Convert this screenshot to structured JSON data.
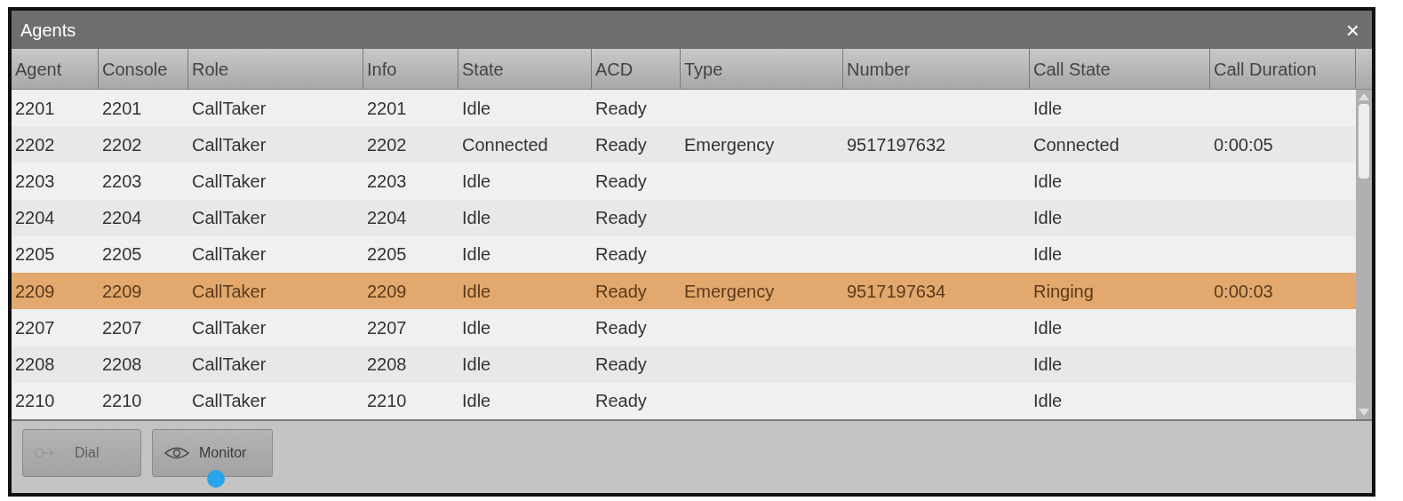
{
  "window": {
    "title": "Agents",
    "close": "×"
  },
  "table": {
    "columns": [
      "Agent",
      "Console",
      "Role",
      "Info",
      "State",
      "ACD",
      "Type",
      "Number",
      "Call State",
      "Call Duration"
    ],
    "rows": [
      {
        "cells": [
          "2201",
          "2201",
          "CallTaker",
          "2201",
          "Idle",
          "Ready",
          "",
          "",
          "Idle",
          ""
        ],
        "selected": false
      },
      {
        "cells": [
          "2202",
          "2202",
          "CallTaker",
          "2202",
          "Connected",
          "Ready",
          "Emergency",
          "9517197632",
          "Connected",
          "0:00:05"
        ],
        "selected": false
      },
      {
        "cells": [
          "2203",
          "2203",
          "CallTaker",
          "2203",
          "Idle",
          "Ready",
          "",
          "",
          "Idle",
          ""
        ],
        "selected": false
      },
      {
        "cells": [
          "2204",
          "2204",
          "CallTaker",
          "2204",
          "Idle",
          "Ready",
          "",
          "",
          "Idle",
          ""
        ],
        "selected": false
      },
      {
        "cells": [
          "2205",
          "2205",
          "CallTaker",
          "2205",
          "Idle",
          "Ready",
          "",
          "",
          "Idle",
          ""
        ],
        "selected": false
      },
      {
        "cells": [
          "2209",
          "2209",
          "CallTaker",
          "2209",
          "Idle",
          "Ready",
          "Emergency",
          "9517197634",
          "Ringing",
          "0:00:03"
        ],
        "selected": true
      },
      {
        "cells": [
          "2207",
          "2207",
          "CallTaker",
          "2207",
          "Idle",
          "Ready",
          "",
          "",
          "Idle",
          ""
        ],
        "selected": false
      },
      {
        "cells": [
          "2208",
          "2208",
          "CallTaker",
          "2208",
          "Idle",
          "Ready",
          "",
          "",
          "Idle",
          ""
        ],
        "selected": false
      },
      {
        "cells": [
          "2210",
          "2210",
          "CallTaker",
          "2210",
          "Idle",
          "Ready",
          "",
          "",
          "Idle",
          ""
        ],
        "selected": false
      }
    ]
  },
  "buttons": [
    {
      "label": "Dial",
      "kind": "dial",
      "disabled": true
    },
    {
      "label": "Monitor",
      "kind": "monitor",
      "disabled": false
    }
  ]
}
